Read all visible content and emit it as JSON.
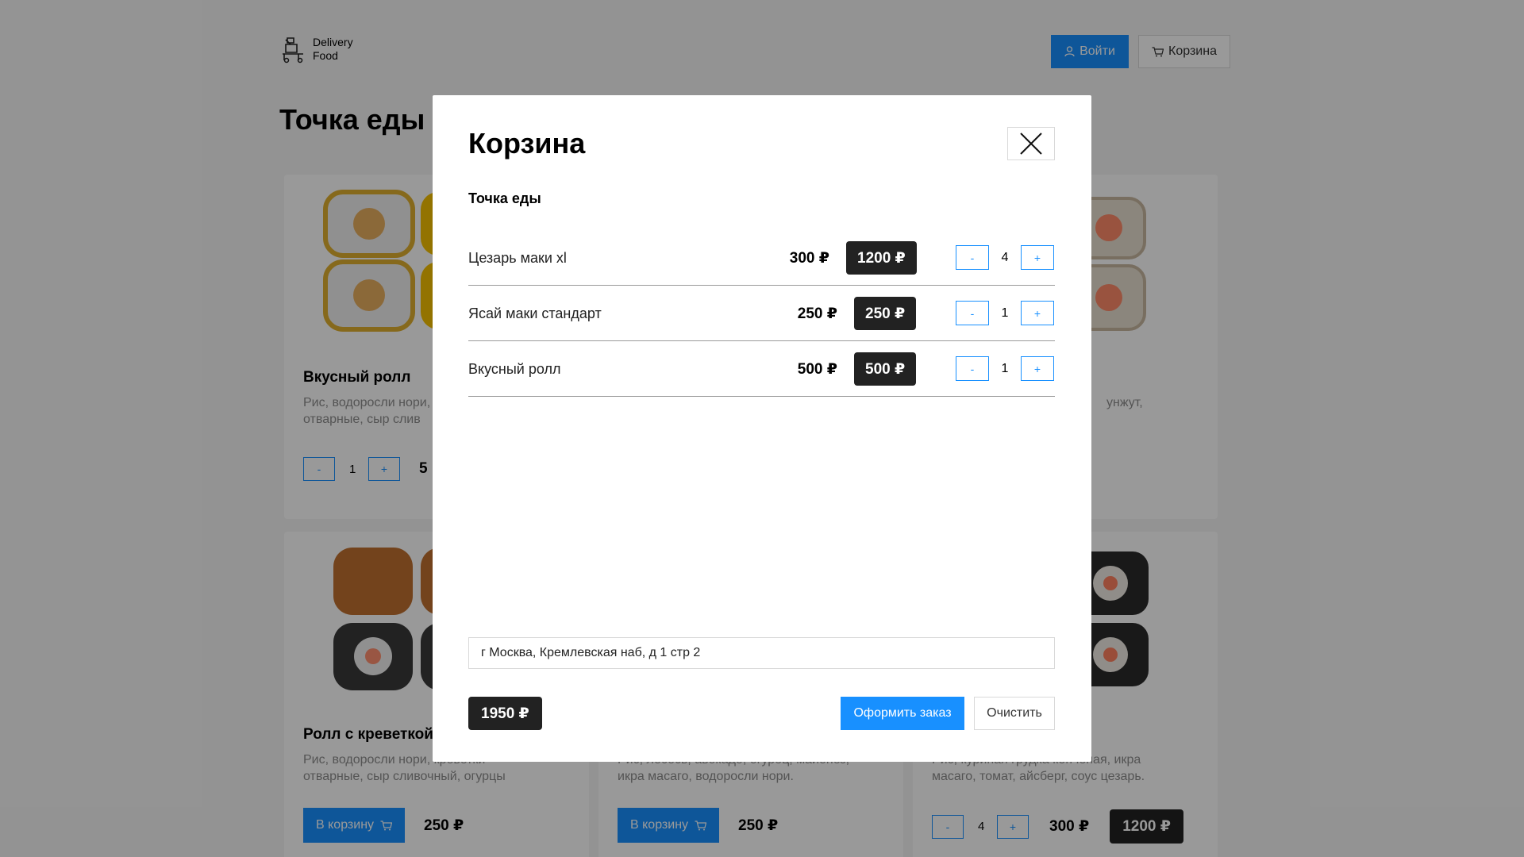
{
  "header": {
    "logo_line1": "Delivery",
    "logo_line2": "Food",
    "login_label": "Войти",
    "cart_label": "Корзина"
  },
  "page": {
    "title": "Точка еды"
  },
  "cards": [
    {
      "title": "Вкусный ролл",
      "desc_line1": "Рис, водоросли нори,",
      "desc_line2": "отварные, сыр слив",
      "qty": "1",
      "price": "5"
    },
    {
      "desc_line1": "унжут,",
      "price": "₽"
    },
    {
      "title": "Ролл с креветкой",
      "desc_line1": "Рис, водоросли нори, креветки",
      "desc_line2": "отварные, сыр сливочный, огурцы",
      "add_label": "В корзину",
      "price": "250 ₽"
    },
    {
      "desc_line1": "Рис, лосось, авокадо, огурец, майонез,",
      "desc_line2": "икра масаго, водоросли нори.",
      "add_label": "В корзину",
      "price": "250 ₽"
    },
    {
      "desc_line1": "Рис, куриная грудка копченая, икра",
      "desc_line2": "масаго, томат, айсберг, соус цезарь.",
      "qty": "4",
      "price": "300 ₽",
      "total": "1200 ₽"
    }
  ],
  "stepper": {
    "minus": "-",
    "plus": "+"
  },
  "modal": {
    "title": "Корзина",
    "subtitle": "Точка еды",
    "items": [
      {
        "name": "Цезарь маки xl",
        "price": "300 ₽",
        "total": "1200 ₽",
        "qty": "4"
      },
      {
        "name": "Ясай маки стандарт",
        "price": "250 ₽",
        "total": "250 ₽",
        "qty": "1"
      },
      {
        "name": "Вкусный ролл",
        "price": "500 ₽",
        "total": "500 ₽",
        "qty": "1"
      }
    ],
    "address_value": "г Москва, Кремлевская наб, д 1 стр 2",
    "total": "1950 ₽",
    "order_label": "Оформить заказ",
    "clear_label": "Очистить"
  },
  "colors": {
    "accent": "#1890ff",
    "dark_badge": "#222222",
    "overlay": "rgba(0,0,0,0.4)"
  },
  "icons": [
    "logo-icon",
    "user-icon",
    "cart-icon",
    "close-icon"
  ]
}
